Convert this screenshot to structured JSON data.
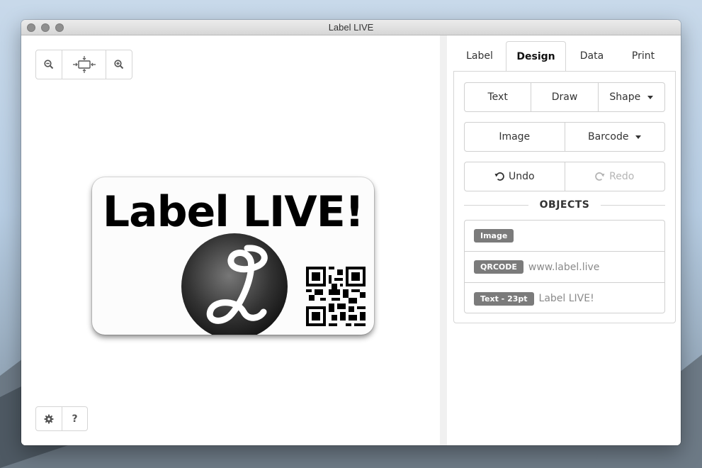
{
  "window": {
    "title": "Label LIVE"
  },
  "zoom_toolbar": {
    "zoom_out_icon": "zoom-out-icon",
    "fit_icon": "fit-to-view-icon",
    "zoom_in_icon": "zoom-in-icon"
  },
  "canvas": {
    "label_text": "Label LIVE!"
  },
  "bottom_toolbar": {
    "settings_icon": "gear-icon",
    "help_label": "?"
  },
  "tabs": [
    {
      "label": "Label",
      "active": false
    },
    {
      "label": "Design",
      "active": true
    },
    {
      "label": "Data",
      "active": false
    },
    {
      "label": "Print",
      "active": false
    }
  ],
  "design": {
    "text_label": "Text",
    "draw_label": "Draw",
    "shape_label": "Shape",
    "image_label": "Image",
    "barcode_label": "Barcode",
    "undo_label": "Undo",
    "redo_label": "Redo"
  },
  "objects": {
    "heading": "OBJECTS",
    "items": [
      {
        "badge": "Image",
        "value": ""
      },
      {
        "badge": "QRCODE",
        "value": "www.label.live"
      },
      {
        "badge": "Text - 23pt",
        "value": "Label LIVE!"
      }
    ]
  },
  "colors": {
    "badge": "#7b7b7b",
    "accent_text": "#333333",
    "disabled": "#b5b5b5"
  }
}
